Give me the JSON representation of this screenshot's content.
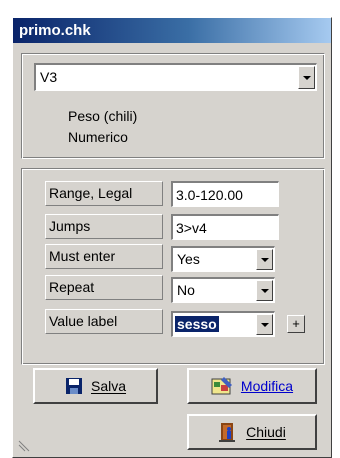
{
  "window": {
    "title": "primo.chk"
  },
  "variable": {
    "selected": "V3",
    "description": "Peso (chili)",
    "type": "Numerico"
  },
  "fields": {
    "range": {
      "label": "Range, Legal",
      "value": "3.0-120.00"
    },
    "jumps": {
      "label": "Jumps",
      "value": "3>v4"
    },
    "must_enter": {
      "label": "Must enter",
      "value": "Yes"
    },
    "repeat": {
      "label": "Repeat",
      "value": "No"
    },
    "value_label": {
      "label": "Value label",
      "value": "sesso"
    },
    "plus_label": "+"
  },
  "buttons": {
    "save": "Salva",
    "edit": "Modifica",
    "close": "Chiudi"
  },
  "icons": {
    "save": "floppy-disk-icon",
    "edit": "edit-picture-icon",
    "close": "door-exit-icon"
  }
}
